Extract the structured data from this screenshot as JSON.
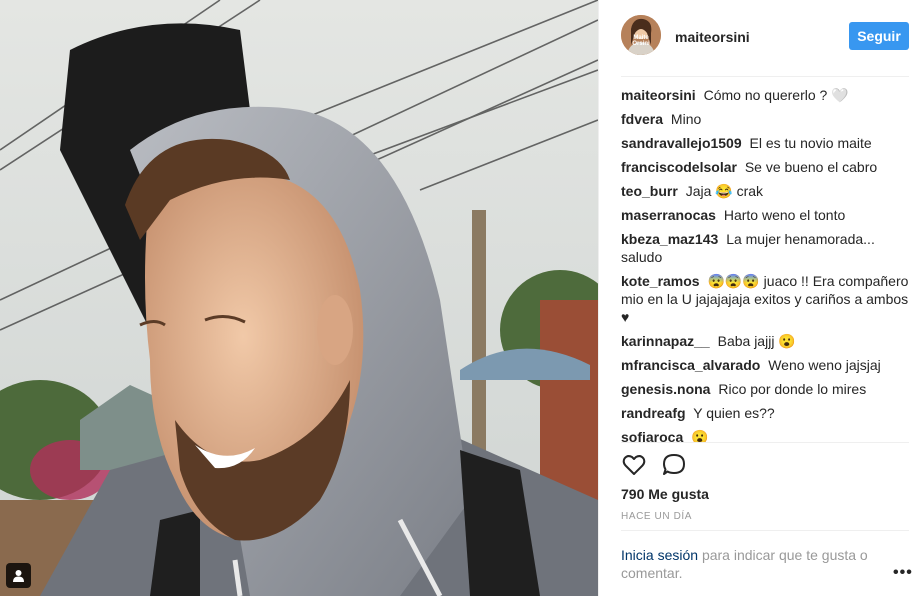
{
  "post": {
    "username": "maiteorsini",
    "avatar_text": "Maite Orsini",
    "follow_label": "Seguir",
    "likes": "790 Me gusta",
    "timestamp": "HACE UN DÍA",
    "login_link": "Inicia sesión",
    "login_rest": "para indicar que te gusta o comentar.",
    "more_label": "•••"
  },
  "comments": [
    {
      "user": "maiteorsini",
      "text": "Cómo no quererlo ? 🤍"
    },
    {
      "user": "fdvera",
      "text": "Mino"
    },
    {
      "user": "sandravallejo1509",
      "text": "El es tu novio maite"
    },
    {
      "user": "franciscodelsolar",
      "text": "Se ve bueno el cabro"
    },
    {
      "user": "teo_burr",
      "text": "Jaja 😂 crak"
    },
    {
      "user": "maserranocas",
      "text": "Harto weno el tonto"
    },
    {
      "user": "kbeza_maz143",
      "text": "La mujer henamorada... saludo"
    },
    {
      "user": "kote_ramos",
      "text": "😨😨😨 juaco !! Era compañero mio en la U jajajajaja exitos y cariños a ambos ♥"
    },
    {
      "user": "karinnapaz__",
      "text": "Baba jajjj 😮"
    },
    {
      "user": "mfrancisca_alvarado",
      "text": "Weno weno jajsjaj"
    },
    {
      "user": "genesis.nona",
      "text": "Rico por donde lo mires"
    },
    {
      "user": "randreafg",
      "text": "Y quien es??"
    },
    {
      "user": "sofiaroca",
      "text": "😮"
    }
  ],
  "icons": {
    "like": "heart-outline-icon",
    "comment": "speech-bubble-icon",
    "tag": "person-tag-icon"
  },
  "colors": {
    "accent": "#3897f0",
    "link": "#003569",
    "muted": "#999999"
  }
}
